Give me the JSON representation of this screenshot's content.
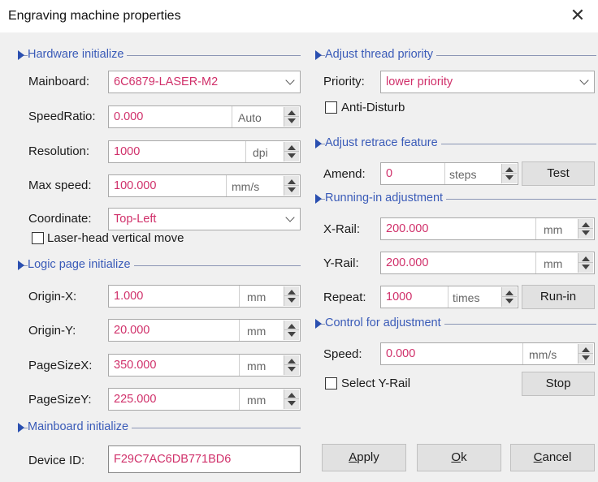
{
  "window": {
    "title": "Engraving machine properties"
  },
  "hardware": {
    "section_title": "Hardware initialize",
    "mainboard_label": "Mainboard:",
    "mainboard_value": "6C6879-LASER-M2",
    "speedratio_label": "SpeedRatio:",
    "speedratio_value": "0.000",
    "speedratio_unit": "Auto",
    "resolution_label": "Resolution:",
    "resolution_value": "1000",
    "resolution_unit": "dpi",
    "maxspeed_label": "Max speed:",
    "maxspeed_value": "100.000",
    "maxspeed_unit": "mm/s",
    "coordinate_label": "Coordinate:",
    "coordinate_value": "Top-Left",
    "laser_head_label": "Laser-head vertical move"
  },
  "logic_page": {
    "section_title": "Logic page initialize",
    "origin_x_label": "Origin-X:",
    "origin_x_value": "1.000",
    "origin_x_unit": "mm",
    "origin_y_label": "Origin-Y:",
    "origin_y_value": "20.000",
    "origin_y_unit": "mm",
    "pagesize_x_label": "PageSizeX:",
    "pagesize_x_value": "350.000",
    "pagesize_x_unit": "mm",
    "pagesize_y_label": "PageSizeY:",
    "pagesize_y_value": "225.000",
    "pagesize_y_unit": "mm"
  },
  "mainboard_init": {
    "section_title": "Mainboard initialize",
    "device_id_label": "Device ID:",
    "device_id_value": "F29C7AC6DB771BD6"
  },
  "thread_priority": {
    "section_title": "Adjust thread priority",
    "priority_label": "Priority:",
    "priority_value": "lower priority",
    "anti_disturb_label": "Anti-Disturb"
  },
  "retrace": {
    "section_title": "Adjust retrace feature",
    "amend_label": "Amend:",
    "amend_value": "0",
    "amend_unit": "steps",
    "test_button": "Test"
  },
  "running_in": {
    "section_title": "Running-in adjustment",
    "x_rail_label": "X-Rail:",
    "x_rail_value": "200.000",
    "x_rail_unit": "mm",
    "y_rail_label": "Y-Rail:",
    "y_rail_value": "200.000",
    "y_rail_unit": "mm",
    "repeat_label": "Repeat:",
    "repeat_value": "1000",
    "repeat_unit": "times",
    "run_in_button": "Run-in"
  },
  "control": {
    "section_title": "Control for adjustment",
    "speed_label": "Speed:",
    "speed_value": "0.000",
    "speed_unit": "mm/s",
    "select_y_rail_label": "Select Y-Rail",
    "stop_button": "Stop"
  },
  "footer": {
    "apply_first": "A",
    "apply_rest": "pply",
    "ok_first": "O",
    "ok_rest": "k",
    "cancel_first": "C",
    "cancel_rest": "ancel"
  },
  "colors": {
    "value_text": "#d0306a",
    "section_title": "#3a5bb8",
    "section_marker": "#2a4fb0"
  }
}
